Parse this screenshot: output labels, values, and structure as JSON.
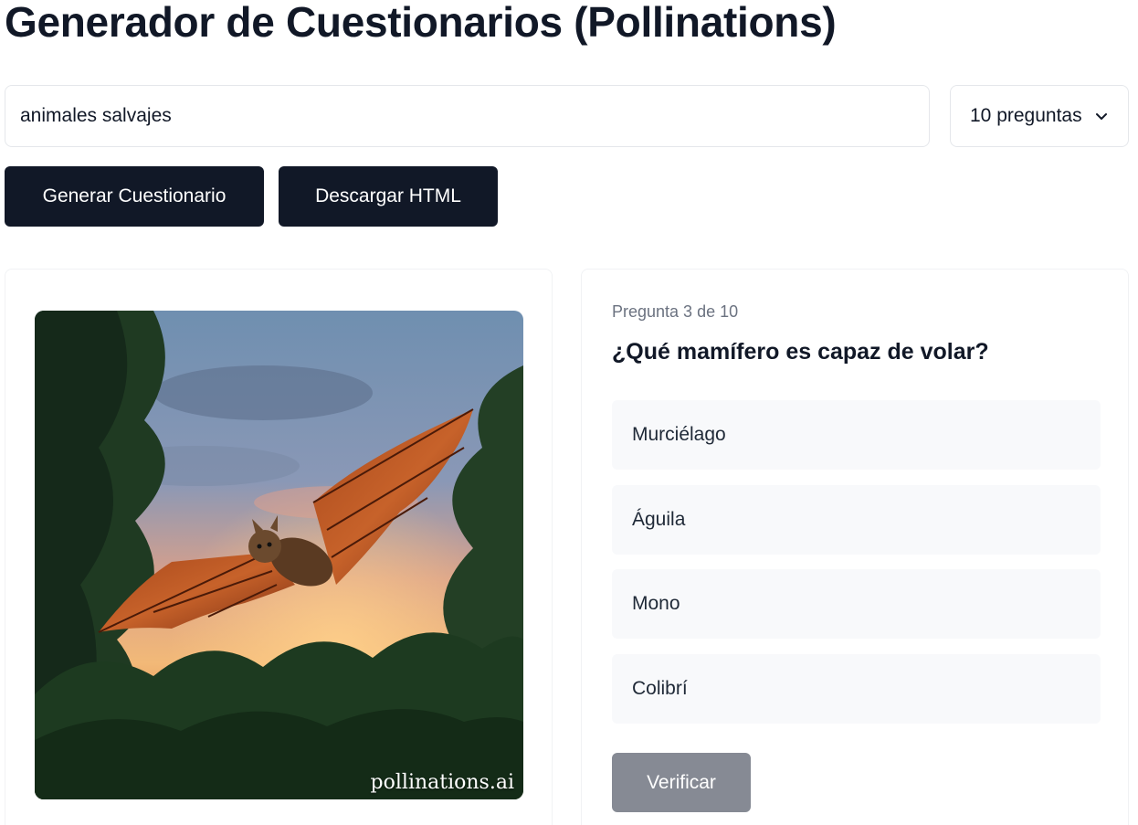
{
  "title": "Generador de Cuestionarios (Pollinations)",
  "controls": {
    "topic_value": "animales salvajes",
    "question_count": "10 preguntas",
    "generate_label": "Generar Cuestionario",
    "download_label": "Descargar HTML"
  },
  "image": {
    "watermark": "pollinations.ai"
  },
  "quiz": {
    "progress": "Pregunta 3 de 10",
    "question": "¿Qué mamífero es capaz de volar?",
    "options": [
      "Murciélago",
      "Águila",
      "Mono",
      "Colibrí"
    ],
    "verify_label": "Verificar"
  },
  "colors": {
    "primary_button": "#111827",
    "disabled_button": "#868a94",
    "option_background": "#f8f9fb"
  }
}
